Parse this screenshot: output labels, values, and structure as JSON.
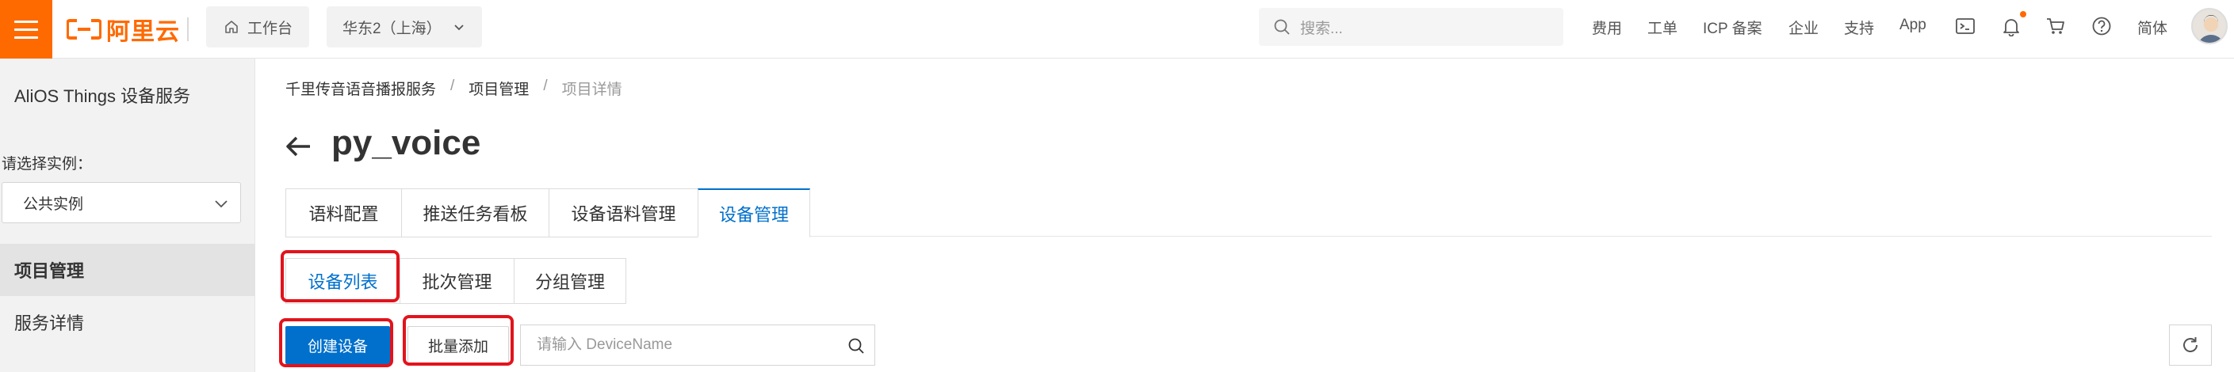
{
  "topbar": {
    "logo_text": "阿里云",
    "workbench_label": "工作台",
    "region_label": "华东2（上海）",
    "search_placeholder": "搜索...",
    "links": [
      "费用",
      "工单",
      "ICP 备案",
      "企业",
      "支持",
      "App"
    ],
    "language_label": "简体",
    "icons": [
      "menu-icon",
      "home-icon",
      "chevron-down-icon",
      "search-icon",
      "terminal-icon",
      "bell-icon",
      "cart-icon",
      "help-icon",
      "avatar"
    ]
  },
  "sidebar": {
    "title": "AliOS Things 设备服务",
    "instance_label": "请选择实例：",
    "instance_value": "公共实例",
    "items": [
      {
        "label": "项目管理",
        "active": true
      },
      {
        "label": "服务详情",
        "active": false
      }
    ]
  },
  "breadcrumb": {
    "items": [
      "千里传音语音播报服务",
      "项目管理",
      "项目详情"
    ],
    "separator": "/"
  },
  "page": {
    "title": "py_voice"
  },
  "tabs": [
    {
      "label": "语料配置",
      "active": false
    },
    {
      "label": "推送任务看板",
      "active": false
    },
    {
      "label": "设备语料管理",
      "active": false
    },
    {
      "label": "设备管理",
      "active": true
    }
  ],
  "subtabs": [
    {
      "label": "设备列表",
      "active": true
    },
    {
      "label": "批次管理",
      "active": false
    },
    {
      "label": "分组管理",
      "active": false
    }
  ],
  "toolbar": {
    "create_label": "创建设备",
    "batch_add_label": "批量添加",
    "device_search_placeholder": "请输入 DeviceName"
  },
  "colors": {
    "brand": "#ff6a00",
    "primary": "#0070cc",
    "highlight": "#e2131c"
  }
}
